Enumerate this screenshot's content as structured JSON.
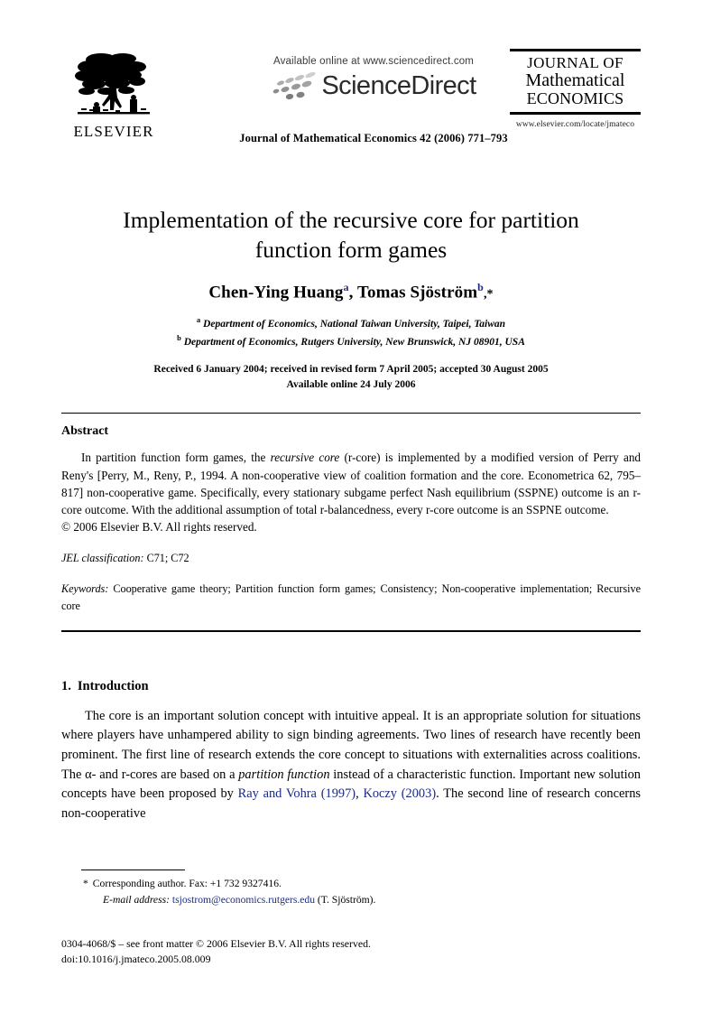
{
  "publisher": {
    "name": "ELSEVIER",
    "logo_icon": "elsevier-tree-icon"
  },
  "sciencedirect": {
    "available_text": "Available online at www.sciencedirect.com",
    "wordmark": "ScienceDirect",
    "logo_icon": "sciencedirect-swoosh-icon"
  },
  "journal": {
    "citation_line": "Journal of Mathematical Economics 42 (2006) 771–793",
    "logo_line_1": "JOURNAL OF",
    "logo_line_2": "Mathematical",
    "logo_line_3": "ECONOMICS",
    "url": "www.elsevier.com/locate/jmateco"
  },
  "article": {
    "title": "Implementation of the recursive core for partition function form games",
    "authors_prefix": "Chen-Ying Huang",
    "author_a_marker": "a",
    "authors_middle": ", Tomas Sjöström",
    "author_b_marker": "b",
    "author_star": ",*",
    "affiliation_a_marker": "a",
    "affiliation_a": "Department of Economics, National Taiwan University, Taipei, Taiwan",
    "affiliation_b_marker": "b",
    "affiliation_b": "Department of Economics, Rutgers University, New Brunswick, NJ 08901, USA",
    "received_line": "Received 6 January 2004; received in revised form 7 April 2005; accepted 30 August 2005",
    "available_line": "Available online 24 July 2006"
  },
  "abstract": {
    "heading": "Abstract",
    "text_part_1": "In partition function form games, the ",
    "italic_1": "recursive core",
    "text_part_2": " (r-core) is implemented by a modified version of Perry and Reny's [Perry, M., Reny, P., 1994. A non-cooperative view of coalition formation and the core. Econometrica 62, 795–817] non-cooperative game. Specifically, every stationary subgame perfect Nash equilibrium (SSPNE) outcome is an r-core outcome. With the additional assumption of total r-balancedness, every r-core outcome is an SSPNE outcome.",
    "copyright": "© 2006 Elsevier B.V. All rights reserved."
  },
  "jel": {
    "label": "JEL classification:",
    "value": "C71; C72"
  },
  "keywords": {
    "label": "Keywords:",
    "value": "Cooperative game theory; Partition function form games; Consistency; Non-cooperative implementation; Recursive core"
  },
  "section": {
    "number": "1.",
    "heading": "Introduction",
    "para_1_a": "The core is an important solution concept with intuitive appeal. It is an appropriate solution for situations where players have unhampered ability to sign binding agreements. Two lines of research have recently been prominent. The first line of research extends the core concept to situations with externalities across coalitions. The α- and r-cores are based on a ",
    "para_1_italic": "partition function",
    "para_1_b": " instead of a characteristic function. Important new solution concepts have been proposed by ",
    "citation_1": "Ray and Vohra (1997)",
    "para_1_sep": ", ",
    "citation_2": "Koczy (2003)",
    "para_1_c": ". The second line of research concerns non-cooperative"
  },
  "footnotes": {
    "star": "*",
    "corresponding": "Corresponding author. Fax: +1 732 9327416.",
    "email_label": "E-mail address:",
    "email_value": "tsjostrom@economics.rutgers.edu",
    "email_suffix": " (T. Sjöström).",
    "issn_line": "0304-4068/$ – see front matter © 2006 Elsevier B.V. All rights reserved.",
    "doi_line": "doi:10.1016/j.jmateco.2005.08.009"
  },
  "colors": {
    "link": "#1a2a8a",
    "text": "#000000",
    "background": "#ffffff"
  }
}
